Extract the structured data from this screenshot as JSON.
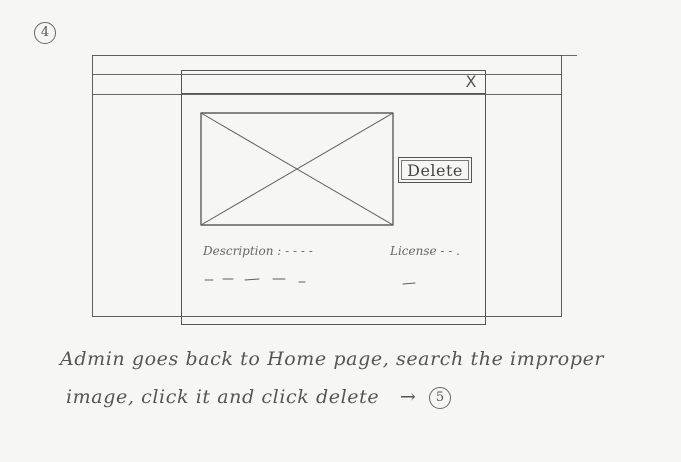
{
  "step_number": "4",
  "modal": {
    "close_glyph": "X",
    "delete_label": "Delete",
    "description_label": "Description : - - - -",
    "license_label": "License - - ."
  },
  "caption": {
    "line1": "Admin goes back to Home page, search the improper",
    "line2": "image, click it and click delete",
    "arrow": "→",
    "next_step": "5"
  },
  "icons": {
    "image_placeholder": "image-placeholder-icon",
    "close": "close-icon",
    "arrow": "arrow-right-icon"
  }
}
